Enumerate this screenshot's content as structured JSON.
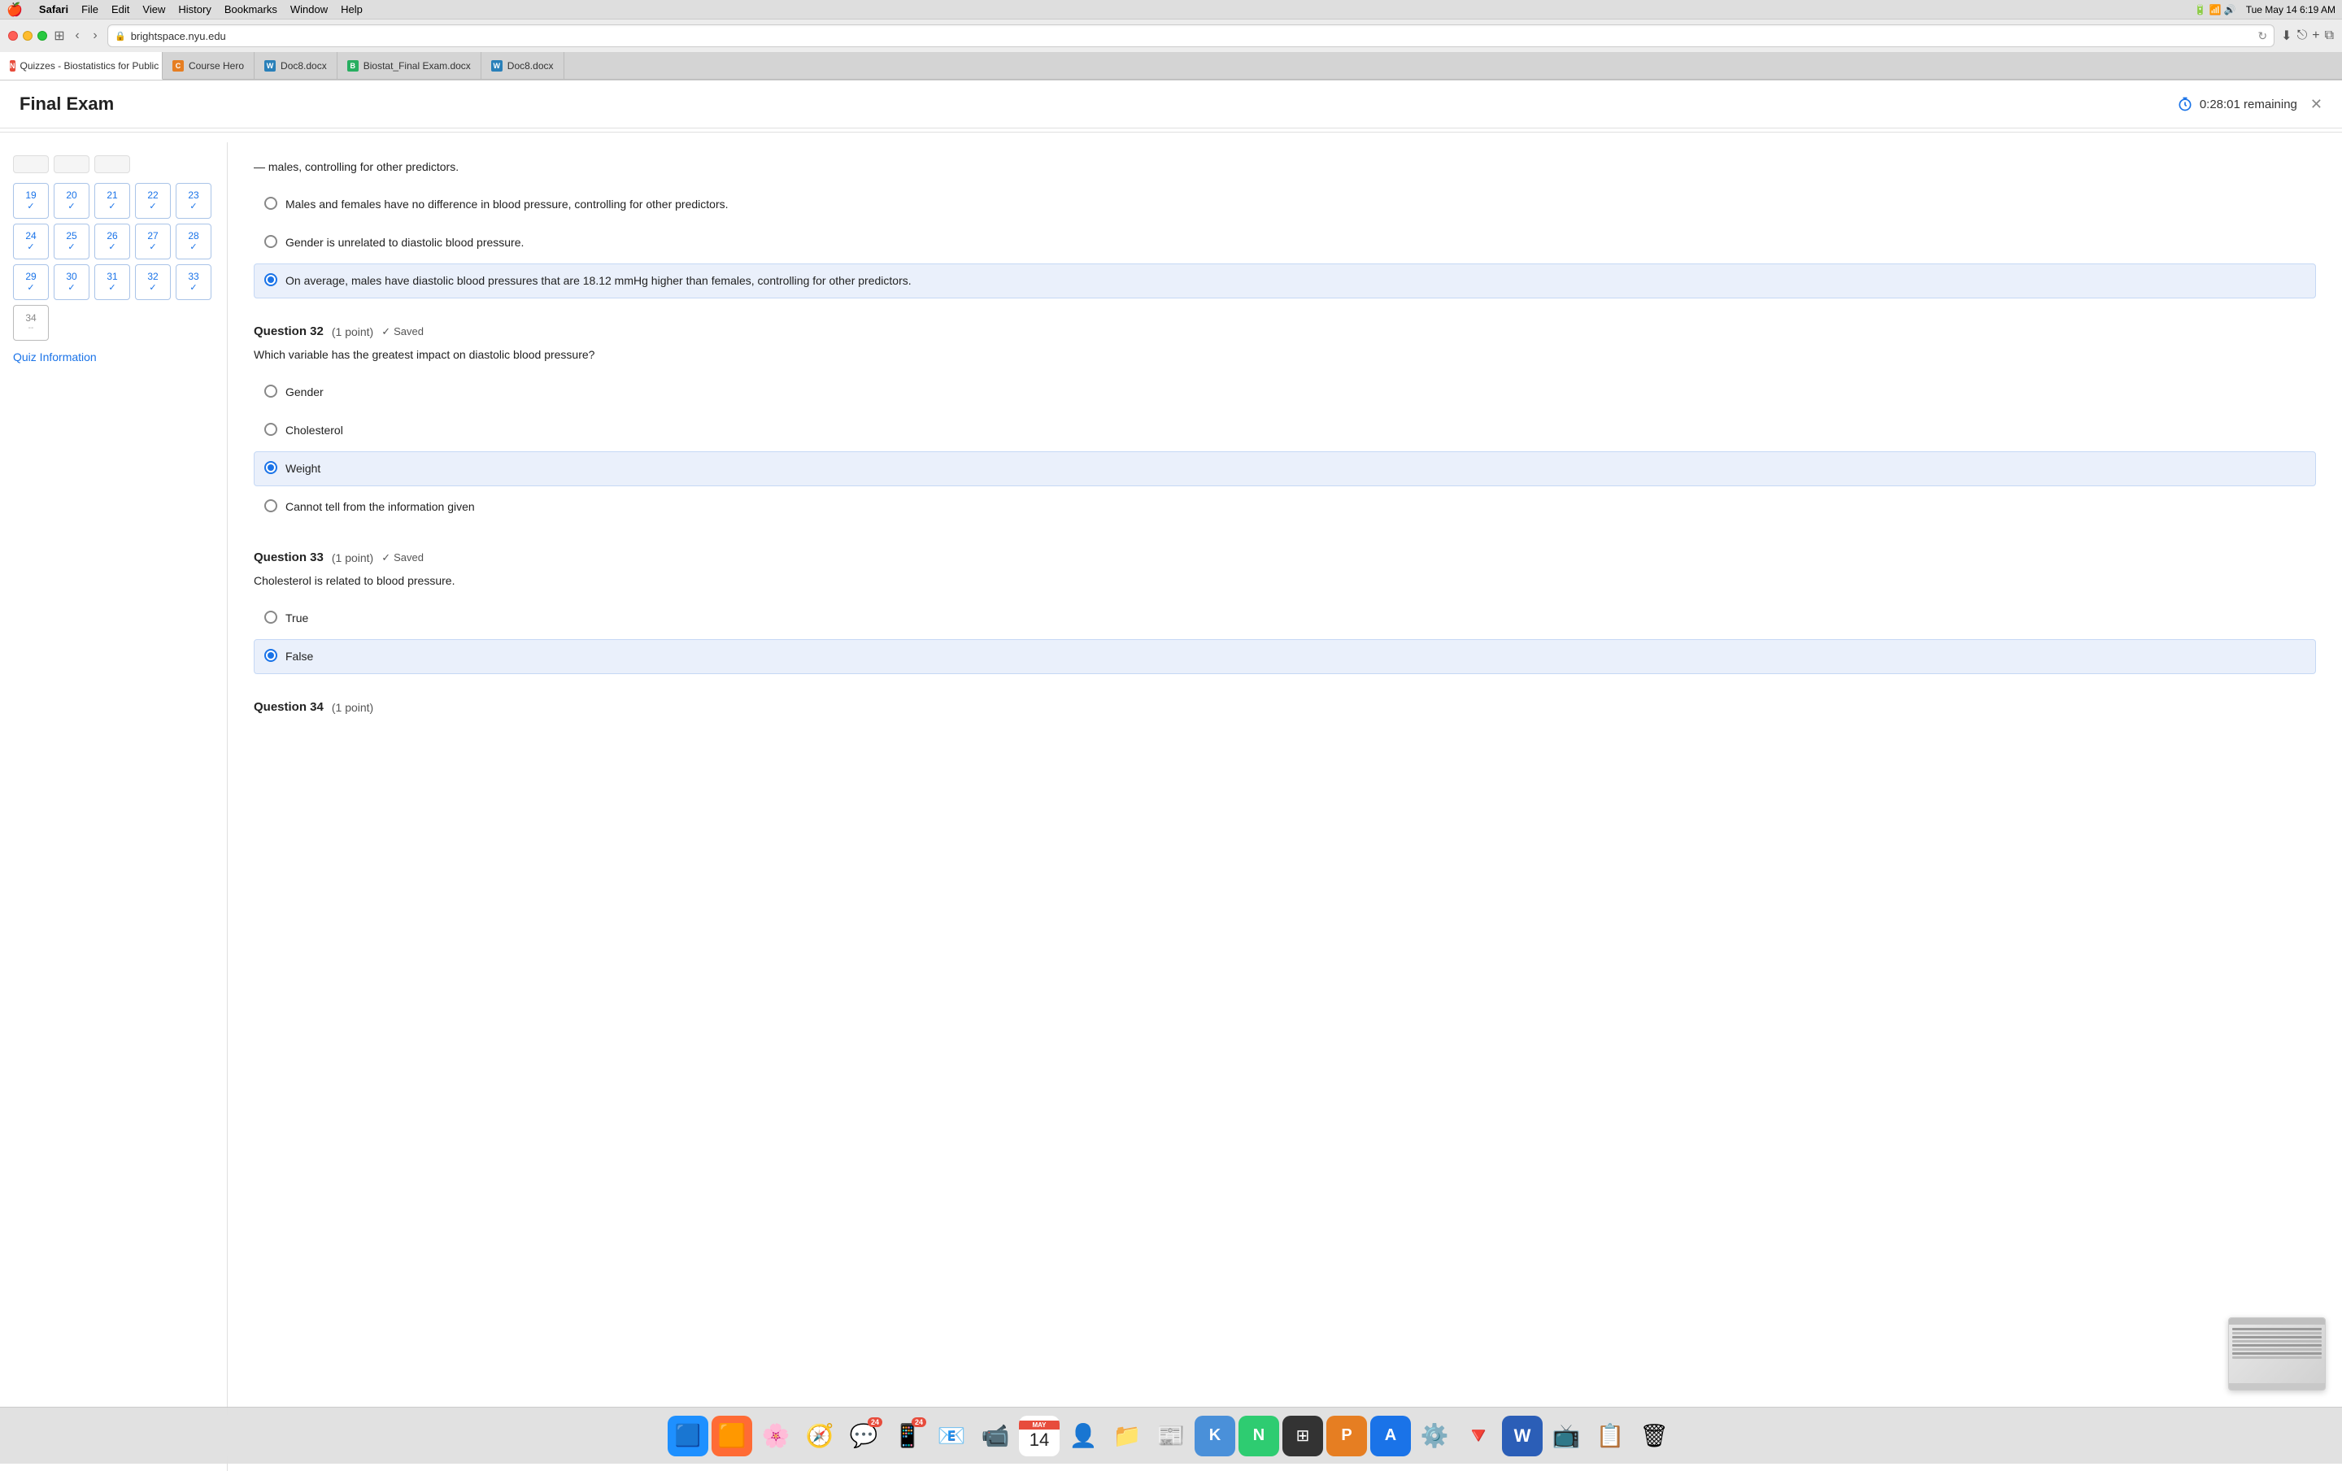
{
  "menubar": {
    "apple": "🍎",
    "app": "Safari",
    "menus": [
      "File",
      "Edit",
      "View",
      "History",
      "Bookmarks",
      "Window",
      "Help"
    ],
    "time": "Tue May 14  6:19 AM"
  },
  "browser": {
    "url": "brightspace.nyu.edu",
    "tabs": [
      {
        "id": "tab1",
        "label": "Quizzes - Biostatistics for Public Health,...",
        "favicon_type": "n",
        "active": true
      },
      {
        "id": "tab2",
        "label": "Course Hero",
        "favicon_type": "c",
        "active": false
      },
      {
        "id": "tab3",
        "label": "Doc8.docx",
        "favicon_type": "w",
        "active": false
      },
      {
        "id": "tab4",
        "label": "Biostat_Final Exam.docx",
        "favicon_type": "b",
        "active": false
      },
      {
        "id": "tab5",
        "label": "Doc8.docx",
        "favicon_type": "w",
        "active": false
      }
    ]
  },
  "exam": {
    "title": "Final Exam",
    "timer": "0:28:01  remaining"
  },
  "sidebar": {
    "partial_rows": 3,
    "question_groups": [
      {
        "nums": [
          19,
          20,
          21
        ],
        "answered": [
          true,
          true,
          true
        ]
      },
      {
        "nums": [
          22,
          23,
          24
        ],
        "answered": [
          true,
          true,
          true
        ]
      },
      {
        "nums": [
          25,
          26,
          27
        ],
        "answered": [
          true,
          true,
          true
        ]
      },
      {
        "nums": [
          28,
          29,
          30
        ],
        "answered": [
          true,
          true,
          true
        ]
      },
      {
        "nums": [
          31,
          32,
          33
        ],
        "answered": [
          true,
          true,
          true
        ]
      },
      {
        "nums": [
          34
        ],
        "answered": [
          false
        ]
      }
    ],
    "quiz_info_label": "Quiz Information"
  },
  "questions": [
    {
      "id": "q31_partial",
      "partial_text": "males, controlling for other predictors.",
      "options": [
        {
          "id": "q31_a",
          "text": "Males and females have no difference in blood pressure, controlling for other predictors.",
          "selected": false
        },
        {
          "id": "q31_b",
          "text": "Gender is unrelated to diastolic blood pressure.",
          "selected": false
        },
        {
          "id": "q31_c",
          "text": "On average, males have diastolic blood pressures that are 18.12 mmHg higher than females, controlling for other predictors.",
          "selected": true
        }
      ]
    },
    {
      "id": "q32",
      "label": "Question 32",
      "points": "(1 point)",
      "saved": "Saved",
      "text": "Which variable has the greatest impact on diastolic blood pressure?",
      "options": [
        {
          "id": "q32_a",
          "text": "Gender",
          "selected": false
        },
        {
          "id": "q32_b",
          "text": "Cholesterol",
          "selected": false
        },
        {
          "id": "q32_c",
          "text": "Weight",
          "selected": true
        },
        {
          "id": "q32_d",
          "text": "Cannot tell from the information given",
          "selected": false
        }
      ]
    },
    {
      "id": "q33",
      "label": "Question 33",
      "points": "(1 point)",
      "saved": "Saved",
      "text": "Cholesterol is related to blood pressure.",
      "options": [
        {
          "id": "q33_a",
          "text": "True",
          "selected": false
        },
        {
          "id": "q33_b",
          "text": "False",
          "selected": true
        }
      ]
    },
    {
      "id": "q34_partial",
      "label": "Question 34",
      "points": "(1 point)"
    }
  ],
  "dock": {
    "items": [
      {
        "id": "finder",
        "emoji": "🔵",
        "label": "Finder"
      },
      {
        "id": "launchpad",
        "emoji": "🟣",
        "label": "Launchpad"
      },
      {
        "id": "photos",
        "emoji": "🌸",
        "label": "Photos"
      },
      {
        "id": "safari",
        "emoji": "🧭",
        "label": "Safari"
      },
      {
        "id": "messages",
        "emoji": "💬",
        "label": "Messages",
        "badge": "24"
      },
      {
        "id": "whatsapp",
        "emoji": "📱",
        "label": "WhatsApp",
        "badge": "24"
      },
      {
        "id": "mail",
        "emoji": "📧",
        "label": "Mail"
      },
      {
        "id": "facetime",
        "emoji": "📹",
        "label": "FaceTime"
      },
      {
        "id": "calendar",
        "type": "date",
        "month": "MAY",
        "day": "14"
      },
      {
        "id": "contacts",
        "emoji": "👤",
        "label": "Contacts"
      },
      {
        "id": "files",
        "emoji": "📁",
        "label": "Files"
      },
      {
        "id": "news",
        "emoji": "📰",
        "label": "News"
      },
      {
        "id": "keynote",
        "emoji": "🎯",
        "label": "Keynote"
      },
      {
        "id": "numbers",
        "emoji": "📊",
        "label": "Numbers"
      },
      {
        "id": "squares",
        "emoji": "⬛",
        "label": "Squares"
      },
      {
        "id": "pages",
        "emoji": "📄",
        "label": "Pages"
      },
      {
        "id": "appstore",
        "emoji": "🅰",
        "label": "App Store"
      },
      {
        "id": "settings",
        "emoji": "⚙️",
        "label": "Settings"
      },
      {
        "id": "transmission",
        "emoji": "🔻",
        "label": "Transmission"
      },
      {
        "id": "word",
        "emoji": "W",
        "label": "Word"
      },
      {
        "id": "tv",
        "emoji": "📺",
        "label": "Apple TV"
      },
      {
        "id": "docviewer",
        "emoji": "📋",
        "label": "Doc Viewer"
      },
      {
        "id": "trash",
        "emoji": "🗑",
        "label": "Trash"
      }
    ]
  }
}
